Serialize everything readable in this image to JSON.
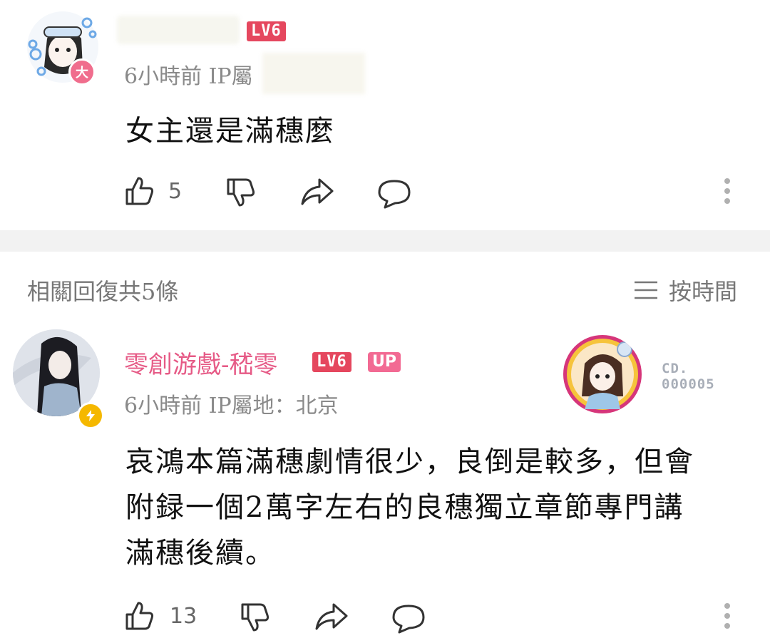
{
  "comment1": {
    "level_badge": "LV6",
    "time_location": "6小時前 IP屬",
    "avatar_badge": "大",
    "text": "女主還是滿穗麼",
    "likes": "5"
  },
  "replies_header": {
    "title": "相關回復共5條",
    "sort_label": "按時間"
  },
  "comment2": {
    "username": "零創游戲-嵇零",
    "level_badge": "LV6",
    "up_badge": "UP",
    "time_location": "6小時前 IP屬地：北京",
    "decoration_code_1": "CD.",
    "decoration_code_2": "000005",
    "text_line1": "哀鴻本篇滿穗劇情很少，良倒是較多，但會",
    "text_line2": "附録一個2萬字左右的良穗獨立章節專門講",
    "text_line3": "滿穗後續。",
    "likes": "13"
  },
  "colors": {
    "level_badge": "#e5475e",
    "up_badge": "#f26a93",
    "username_pink": "#e65a86",
    "divider": "#f2f2f2",
    "meta_gray": "#8a8a8a"
  }
}
